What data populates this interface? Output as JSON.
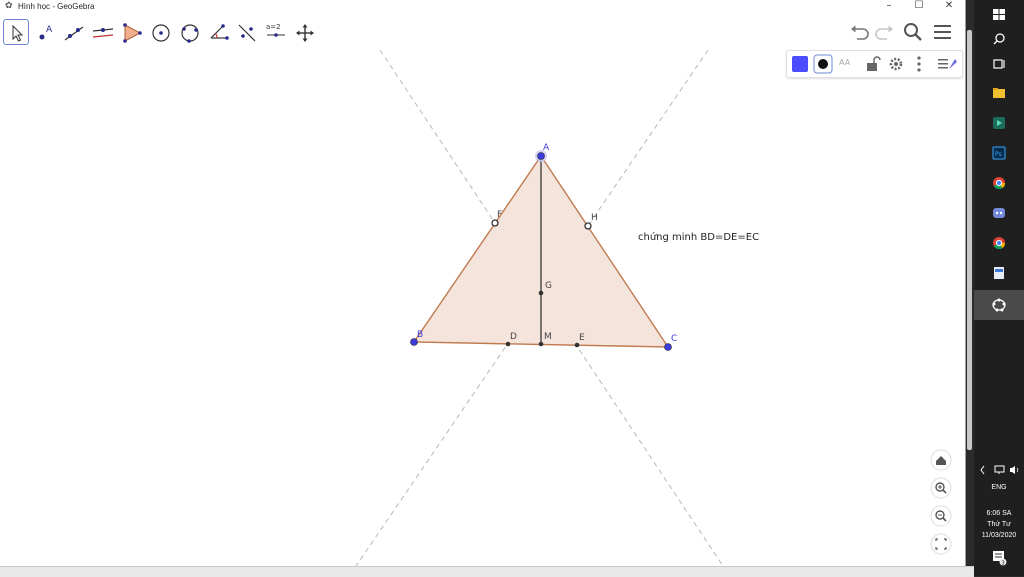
{
  "window": {
    "title": "Hình học - GeoGebra",
    "minimize_glyph": "–",
    "maximize_glyph": "☐",
    "close_glyph": "✕"
  },
  "toolbar": {
    "tools": [
      {
        "icon": "move-icon",
        "active": true
      },
      {
        "icon": "point-icon"
      },
      {
        "icon": "line-icon"
      },
      {
        "icon": "perpendicular-line-icon"
      },
      {
        "icon": "polygon-icon"
      },
      {
        "icon": "circle-center-point-icon"
      },
      {
        "icon": "circle-three-points-icon"
      },
      {
        "icon": "angle-icon"
      },
      {
        "icon": "reflect-icon"
      },
      {
        "icon": "slider-icon",
        "label": "a=2"
      },
      {
        "icon": "move-graphics-icon"
      }
    ],
    "right": [
      "undo-icon",
      "redo-icon",
      "search-icon",
      "menu-icon"
    ]
  },
  "style_bar": {
    "color_swatch": "#4b4bff",
    "aa_label": "AA"
  },
  "canvas": {
    "polygon_fill": "#f4e4dc",
    "polygon_stroke": "#c07a4f",
    "point_color": "#3c3cdc",
    "points": {
      "A": "A",
      "B": "B",
      "C": "C",
      "D": "D",
      "E": "E",
      "F": "F",
      "G": "G",
      "H": "H",
      "M": "M"
    },
    "note": "chứng minh BD=DE=EC"
  },
  "taskbar": {
    "lang": "ENG",
    "time": "6:06 SA",
    "day": "Thứ Tư",
    "date": "11/03/2020",
    "notif_count": "3"
  }
}
